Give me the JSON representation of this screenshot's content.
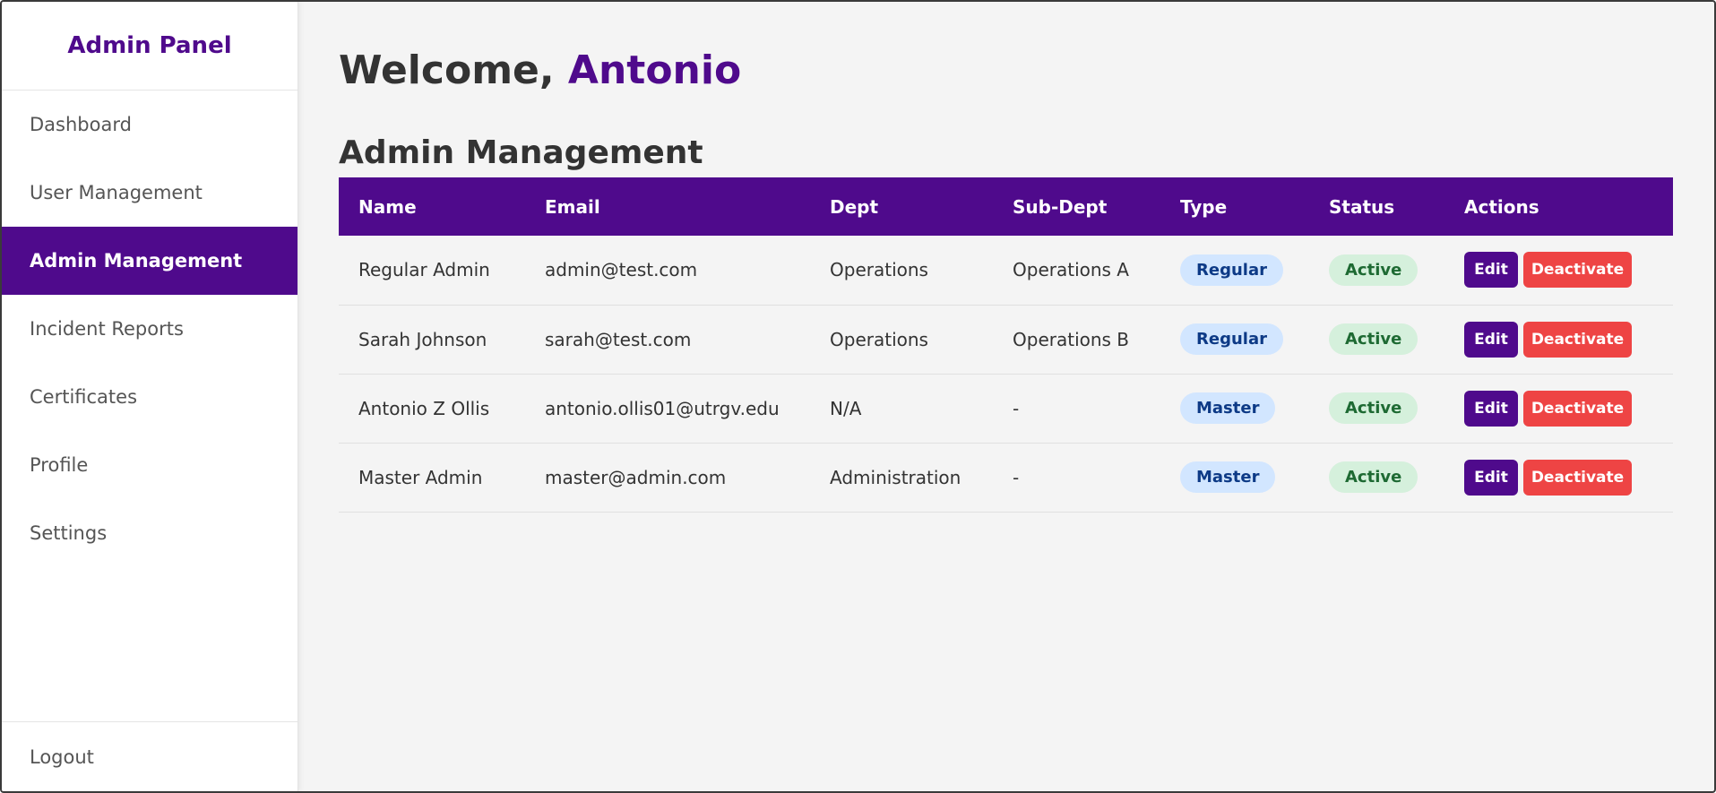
{
  "sidebar": {
    "title": "Admin Panel",
    "items": [
      {
        "label": "Dashboard"
      },
      {
        "label": "User Management"
      },
      {
        "label": "Admin Management"
      },
      {
        "label": "Incident Reports"
      },
      {
        "label": "Certificates"
      },
      {
        "label": "Profile"
      },
      {
        "label": "Settings"
      }
    ],
    "active_index": 2,
    "logout_label": "Logout"
  },
  "header": {
    "welcome_prefix": "Welcome, ",
    "user_name": "Antonio"
  },
  "main": {
    "section_title": "Admin Management",
    "columns": [
      "Name",
      "Email",
      "Dept",
      "Sub-Dept",
      "Type",
      "Status",
      "Actions"
    ],
    "rows": [
      {
        "name": "Regular Admin",
        "email": "admin@test.com",
        "dept": "Operations",
        "sub_dept": "Operations A",
        "type": "Regular",
        "status": "Active"
      },
      {
        "name": "Sarah Johnson",
        "email": "sarah@test.com",
        "dept": "Operations",
        "sub_dept": "Operations B",
        "type": "Regular",
        "status": "Active"
      },
      {
        "name": "Antonio Z Ollis",
        "email": "antonio.ollis01@utrgv.edu",
        "dept": "N/A",
        "sub_dept": "-",
        "type": "Master",
        "status": "Active"
      },
      {
        "name": "Master Admin",
        "email": "master@admin.com",
        "dept": "Administration",
        "sub_dept": "-",
        "type": "Master",
        "status": "Active"
      }
    ],
    "edit_label": "Edit",
    "deactivate_label": "Deactivate"
  },
  "colors": {
    "brand": "#4f0a8c",
    "danger": "#ee4444",
    "type_badge_bg": "#d2e6ff",
    "status_badge_bg": "#d5f0dc"
  }
}
